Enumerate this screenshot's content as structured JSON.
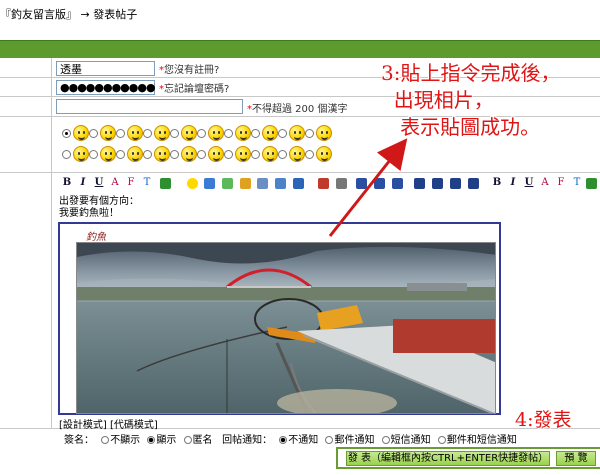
{
  "breadcrumb": {
    "board": "『釣友留言版』",
    "arrow": "→",
    "page": "發表帖子"
  },
  "form": {
    "username_value": "透墨",
    "register_hint": "您沒有註冊?",
    "password_value": "●●●●●●●●●●●",
    "forgot_hint": "忘記論壇密碼?",
    "title_value": "",
    "title_hint": "不得超過 200 個漢字",
    "required_mark": "*"
  },
  "emoji": {
    "row1_count": 10,
    "row2_count": 10,
    "selected_index": 0
  },
  "toolbar": {
    "bold": "B",
    "italic": "I",
    "underline": "U",
    "font": "A",
    "color": "F",
    "size": "T",
    "bold2": "B",
    "italic2": "I",
    "underline2": "U",
    "font2": "A",
    "color2": "F",
    "size2": "T"
  },
  "editor": {
    "line1": "出發要有個方向：",
    "line2": "我要釣魚啦！",
    "photo_signature": "釣魚"
  },
  "modes": {
    "label": "[設計模式] [代碼模式]"
  },
  "options": {
    "sign_label": "簽名：",
    "sign_no": "不顯示",
    "sign_yes": "顯示",
    "anonymous": "匿名",
    "notify_label": "回帖通知：",
    "notify_none": "不通知",
    "notify_mail": "郵件通知",
    "notify_sms": "短信通知",
    "notify_both": "郵件和短信通知"
  },
  "actions": {
    "submit_label": "發 表（編輯框內按CTRL+ENTER快捷發帖）",
    "preview_label": "預 覽"
  },
  "annotations": {
    "step3": "3:貼上指令完成後，\n  出現相片，\n   表示貼圖成功。",
    "step4": "4:發表"
  },
  "colors": {
    "accent_green": "#5e9b2e",
    "annotation_red": "#e01414",
    "frame_blue": "#343a94"
  }
}
